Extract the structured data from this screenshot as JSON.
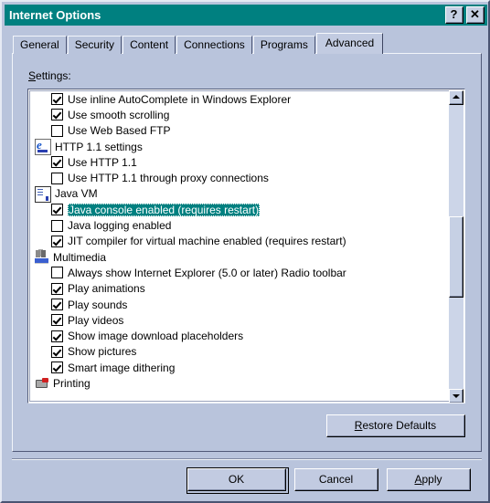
{
  "window": {
    "title": "Internet Options",
    "help_button": "?",
    "close_button": "✕"
  },
  "tabs": [
    {
      "label": "General",
      "active": false
    },
    {
      "label": "Security",
      "active": false
    },
    {
      "label": "Content",
      "active": false
    },
    {
      "label": "Connections",
      "active": false
    },
    {
      "label": "Programs",
      "active": false
    },
    {
      "label": "Advanced",
      "active": true
    }
  ],
  "settings": {
    "group_label_prefix": "S",
    "group_label_rest": "ettings:",
    "items": [
      {
        "kind": "check",
        "label": "Use inline AutoComplete in Windows Explorer",
        "checked": true,
        "selected": false
      },
      {
        "kind": "check",
        "label": "Use smooth scrolling",
        "checked": true,
        "selected": false
      },
      {
        "kind": "check",
        "label": "Use Web Based FTP",
        "checked": false,
        "selected": false
      },
      {
        "kind": "group",
        "label": "HTTP 1.1 settings",
        "icon": "internet-explorer-icon"
      },
      {
        "kind": "check",
        "label": "Use HTTP 1.1",
        "checked": true,
        "selected": false
      },
      {
        "kind": "check",
        "label": "Use HTTP 1.1 through proxy connections",
        "checked": false,
        "selected": false
      },
      {
        "kind": "group",
        "label": "Java VM",
        "icon": "document-icon"
      },
      {
        "kind": "check",
        "label": "Java console enabled (requires restart)",
        "checked": true,
        "selected": true
      },
      {
        "kind": "check",
        "label": "Java logging enabled",
        "checked": false,
        "selected": false
      },
      {
        "kind": "check",
        "label": "JIT compiler for virtual machine enabled (requires restart)",
        "checked": true,
        "selected": false
      },
      {
        "kind": "group",
        "label": "Multimedia",
        "icon": "multimedia-icon"
      },
      {
        "kind": "check",
        "label": "Always show Internet Explorer (5.0 or later) Radio toolbar",
        "checked": false,
        "selected": false
      },
      {
        "kind": "check",
        "label": "Play animations",
        "checked": true,
        "selected": false
      },
      {
        "kind": "check",
        "label": "Play sounds",
        "checked": true,
        "selected": false
      },
      {
        "kind": "check",
        "label": "Play videos",
        "checked": true,
        "selected": false
      },
      {
        "kind": "check",
        "label": "Show image download placeholders",
        "checked": true,
        "selected": false
      },
      {
        "kind": "check",
        "label": "Show pictures",
        "checked": true,
        "selected": false
      },
      {
        "kind": "check",
        "label": "Smart image dithering",
        "checked": true,
        "selected": false
      },
      {
        "kind": "group",
        "label": "Printing",
        "icon": "printer-icon"
      }
    ]
  },
  "buttons": {
    "restore_defaults_accel": "R",
    "restore_defaults_rest": "estore Defaults",
    "ok": "OK",
    "cancel": "Cancel",
    "apply_accel": "A",
    "apply_rest": "pply"
  },
  "colors": {
    "titlebar": "#008080",
    "dialog_face": "#b9c4dc",
    "selection": "#008080",
    "selection_text": "#ffffff",
    "list_background": "#ffffff"
  }
}
